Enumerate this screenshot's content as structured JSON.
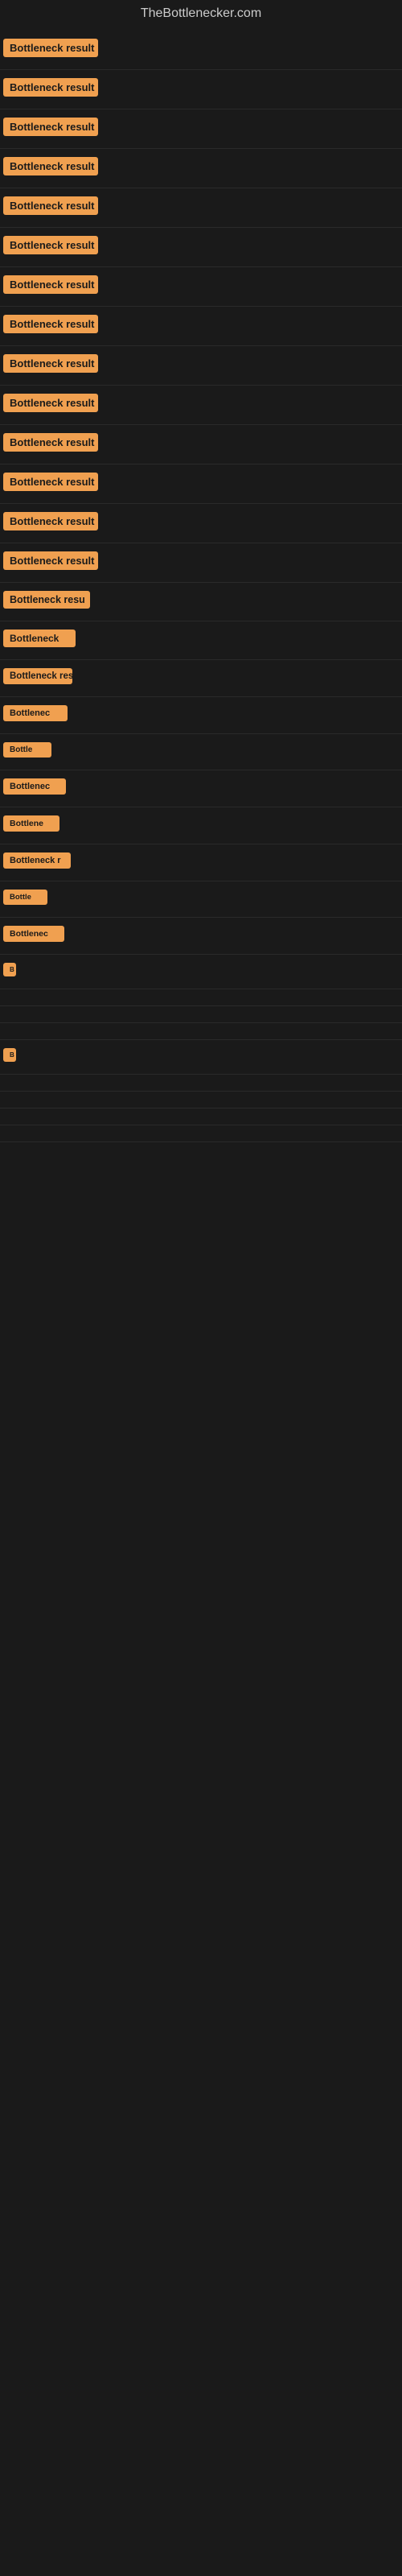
{
  "site": {
    "title": "TheBottlenecker.com"
  },
  "rows": [
    {
      "id": 1,
      "label": "Bottleneck result"
    },
    {
      "id": 2,
      "label": "Bottleneck result"
    },
    {
      "id": 3,
      "label": "Bottleneck result"
    },
    {
      "id": 4,
      "label": "Bottleneck result"
    },
    {
      "id": 5,
      "label": "Bottleneck result"
    },
    {
      "id": 6,
      "label": "Bottleneck result"
    },
    {
      "id": 7,
      "label": "Bottleneck result"
    },
    {
      "id": 8,
      "label": "Bottleneck result"
    },
    {
      "id": 9,
      "label": "Bottleneck result"
    },
    {
      "id": 10,
      "label": "Bottleneck result"
    },
    {
      "id": 11,
      "label": "Bottleneck result"
    },
    {
      "id": 12,
      "label": "Bottleneck result"
    },
    {
      "id": 13,
      "label": "Bottleneck result"
    },
    {
      "id": 14,
      "label": "Bottleneck result"
    },
    {
      "id": 15,
      "label": "Bottleneck resu"
    },
    {
      "id": 16,
      "label": "Bottleneck"
    },
    {
      "id": 17,
      "label": "Bottleneck res"
    },
    {
      "id": 18,
      "label": "Bottlenec"
    },
    {
      "id": 19,
      "label": "Bottle"
    },
    {
      "id": 20,
      "label": "Bottlenec"
    },
    {
      "id": 21,
      "label": "Bottlene"
    },
    {
      "id": 22,
      "label": "Bottleneck r"
    },
    {
      "id": 23,
      "label": "Bottle"
    },
    {
      "id": 24,
      "label": "Bottlenec"
    },
    {
      "id": 25,
      "label": "B"
    },
    {
      "id": 26,
      "label": ""
    },
    {
      "id": 27,
      "label": ""
    },
    {
      "id": 28,
      "label": ""
    },
    {
      "id": 29,
      "label": "B"
    },
    {
      "id": 30,
      "label": ""
    },
    {
      "id": 31,
      "label": ""
    },
    {
      "id": 32,
      "label": ""
    },
    {
      "id": 33,
      "label": ""
    }
  ],
  "colors": {
    "background": "#1a1a1a",
    "label_bg": "#f0a050",
    "label_text": "#1a1a1a",
    "title_text": "#cccccc"
  }
}
